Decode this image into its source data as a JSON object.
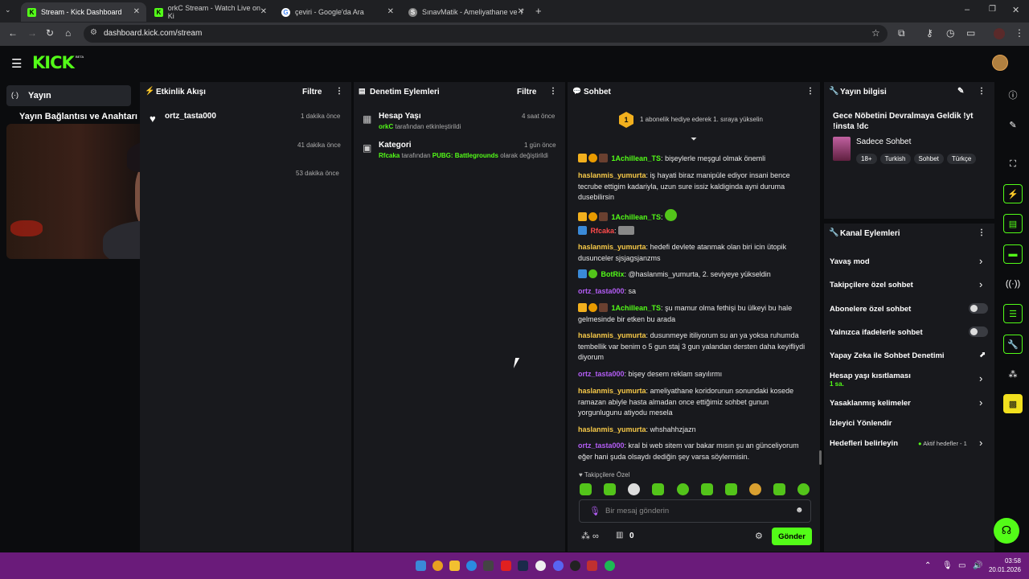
{
  "browser": {
    "tabs": [
      {
        "title": "Stream - Kick Dashboard",
        "fav": "K"
      },
      {
        "title": "orkC Stream - Watch Live on Ki",
        "fav": "K"
      },
      {
        "title": "çeviri - Google'da Ara",
        "fav": "G"
      },
      {
        "title": "SınavMatik - Ameliyathane ve Y",
        "fav": "S"
      }
    ],
    "url": "dashboard.kick.com/stream"
  },
  "brand": {
    "logo": "KICK",
    "beta": "BETA"
  },
  "sidebar": {
    "stream_label": "Yayın",
    "stream_key_label": "Yayın Bağlantısı ve Anahtarı"
  },
  "activity": {
    "title": "Etkinlik Akışı",
    "filter": "Filtre",
    "items": [
      {
        "user": "ortz_tasta000",
        "time": "1 dakika önce"
      },
      {
        "user": "",
        "time": "41 dakika önce"
      },
      {
        "user": "",
        "time": "53 dakika önce"
      }
    ]
  },
  "moderation": {
    "title": "Denetim Eylemleri",
    "filter": "Filtre",
    "items": [
      {
        "title": "Hesap Yaşı",
        "time": "4 saat önce",
        "actor": "orkC",
        "desc": "tarafından etkinleştirildi",
        "extra": ""
      },
      {
        "title": "Kategori",
        "time": "1 gün önce",
        "actor": "Rfcaka",
        "desc": "tarafından",
        "extra": "PUBG: Battlegrounds",
        "desc2": "olarak değiştirildi"
      }
    ]
  },
  "chat": {
    "title": "Sohbet",
    "gift_banner": "1 abonelik hediye ederek 1. sıraya yükselin",
    "gift_rank": "1",
    "messages": [
      {
        "user": "1Achillean_TS",
        "color": "green",
        "text": "bişeylerle meşgul olmak önemli"
      },
      {
        "user": "haslanmis_yumurta",
        "color": "yellow",
        "text": "iş hayati biraz manipüle ediyor insani bence tecrube ettigim kadariyla, uzun sure issiz kaldiginda ayni duruma dusebilirsin"
      },
      {
        "user": "1Achillean_TS",
        "color": "green",
        "text": ""
      },
      {
        "user": "Rfcaka",
        "color": "red",
        "text": ""
      },
      {
        "user": "haslanmis_yumurta",
        "color": "yellow",
        "text": "hedefi devlete atanmak olan biri icin ütopik dusunceler sjsjagsjanzms"
      },
      {
        "user": "BotRix",
        "color": "green",
        "text": "@haslanmis_yumurta, 2. seviyeye yükseldin"
      },
      {
        "user": "ortz_tasta000",
        "color": "purple",
        "text": "sa"
      },
      {
        "user": "1Achillean_TS",
        "color": "green",
        "text": "şu mamur olma fethişi bu ülkeyi bu hale gelmesinde bir etken bu arada"
      },
      {
        "user": "haslanmis_yumurta",
        "color": "yellow",
        "text": "dusunmeye itiliyorum su an ya yoksa ruhumda tembellik var benim o 5 gun staj 3 gun yalandan dersten daha keyifliydi diyorum"
      },
      {
        "user": "ortz_tasta000",
        "color": "purple",
        "text": "bişey desem reklam sayılırmı"
      },
      {
        "user": "haslanmis_yumurta",
        "color": "yellow",
        "text": "ameliyathane koridorunun sonundaki kosede ramazan abiyle hasta almadan once ettiğimiz sohbet gunun yorgunlugunu atiyodu mesela"
      },
      {
        "user": "haslanmis_yumurta",
        "color": "yellow",
        "text": "whshahhzjazn"
      },
      {
        "user": "ortz_tasta000",
        "color": "purple",
        "text": "kral bi web sitem var bakar mısın şu an günceliyorum eğer hani şuda olsaydı dediğin şey varsa söylermisin."
      }
    ],
    "followers_only": "Takipçilere Özel",
    "input_placeholder": "Bir mesaj gönderin",
    "points": "0",
    "send_label": "Gönder"
  },
  "stream_info": {
    "title": "Yayın bilgisi",
    "stream_title": "Gece Nöbetini Devralmaya Geldik !yt !insta !dc",
    "category": "Sadece Sohbet",
    "tags": [
      "18+",
      "Turkish",
      "Sohbet",
      "Türkçe"
    ]
  },
  "channel_actions": {
    "title": "Kanal Eylemleri",
    "items": [
      {
        "label": "Yavaş mod",
        "control": "chevron"
      },
      {
        "label": "Takipçilere özel sohbet",
        "control": "chevron"
      },
      {
        "label": "Abonelere özel sohbet",
        "control": "toggle"
      },
      {
        "label": "Yalnızca ifadelerle sohbet",
        "control": "toggle"
      },
      {
        "label": "Yapay Zeka ile Sohbet Denetimi",
        "control": "chart"
      },
      {
        "label": "Hesap yaşı kısıtlaması",
        "sub": "1 sa.",
        "control": "chevron"
      },
      {
        "label": "Yasaklanmış kelimeler",
        "control": "chevron"
      },
      {
        "label": "İzleyici Yönlendir",
        "control": "none"
      },
      {
        "label": "Hedefleri belirleyin",
        "extra": "Aktif hedefler - 1",
        "control": "chevron"
      }
    ]
  },
  "system": {
    "time": "03:58",
    "date": "20.01.2026"
  },
  "colors": {
    "kick_green": "#53fc18",
    "taskbar": "#6a1b7a",
    "panel": "#18191d"
  }
}
